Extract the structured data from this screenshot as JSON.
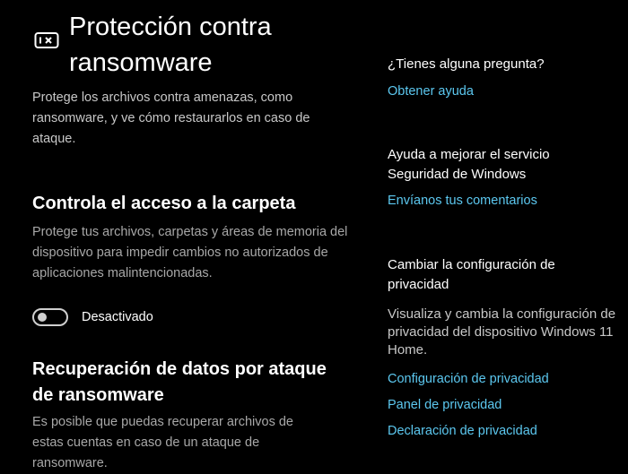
{
  "header": {
    "title": "Protección contra ransomware",
    "icon": "ransomware-shield-icon"
  },
  "main": {
    "description": "Protege los archivos contra amenazas, como ransomware, y ve cómo restaurarlos en caso de ataque.",
    "folder_access": {
      "heading": "Controla el acceso a la carpeta",
      "description": "Protege tus archivos, carpetas y áreas de memoria del dispositivo para impedir cambios no autorizados de aplicaciones malintencionadas.",
      "toggle_state": "off",
      "toggle_label": "Desactivado"
    },
    "recovery": {
      "heading": "Recuperación de datos por ataque de ransomware",
      "description": "Es posible que puedas recuperar archivos de estas cuentas en caso de un ataque de ransomware."
    }
  },
  "sidebar": {
    "question": {
      "heading": "¿Tienes alguna pregunta?",
      "link": "Obtener ayuda"
    },
    "improve": {
      "heading": "Ayuda a mejorar el servicio Seguridad de Windows",
      "link": "Envíanos tus comentarios"
    },
    "privacy": {
      "heading": "Cambiar la configuración de privacidad",
      "text": "Visualiza y cambia la configuración de privacidad del dispositivo Windows 11 Home.",
      "links": [
        "Configuración de privacidad",
        "Panel de privacidad",
        "Declaración de privacidad"
      ]
    }
  },
  "colors": {
    "background": "#000000",
    "link": "#5cc8f0",
    "secondary_text": "#c8c8c8"
  }
}
